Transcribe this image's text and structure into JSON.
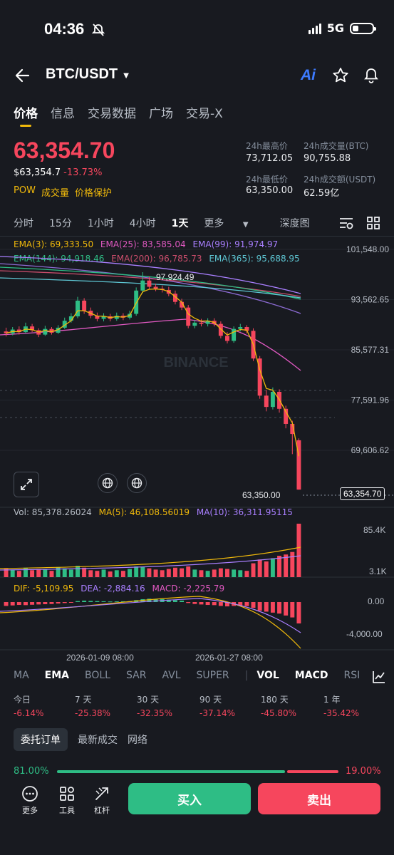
{
  "status": {
    "time": "04:36",
    "network": "5G"
  },
  "header": {
    "pair": "BTC/USDT",
    "ai_label": "Ai"
  },
  "tabs": [
    {
      "label": "价格"
    },
    {
      "label": "信息"
    },
    {
      "label": "交易数据"
    },
    {
      "label": "广场"
    },
    {
      "label": "交易-X"
    }
  ],
  "ticker": {
    "price": "63,354.70",
    "usd_price": "$63,354.7",
    "change": "-13.73%",
    "tags": [
      "POW",
      "成交量",
      "价格保护"
    ],
    "high_label": "24h最高价",
    "high": "73,712.05",
    "low_label": "24h最低价",
    "low": "63,350.00",
    "vol_btc_label": "24h成交量(BTC)",
    "vol_btc": "90,755.88",
    "vol_usdt_label": "24h成交额(USDT)",
    "vol_usdt": "62.59亿"
  },
  "intervals": {
    "items": [
      "分时",
      "15分",
      "1小时",
      "4小时",
      "1天"
    ],
    "more": "更多",
    "depth": "深度图",
    "selected": "1天"
  },
  "ema": {
    "ema3": "EMA(3): 69,333.50",
    "ema25": "EMA(25): 83,585.04",
    "ema99": "EMA(99): 91,974.97",
    "ema144": "EMA(144): 94,918.46",
    "ema200": "EMA(200): 96,785.73",
    "ema365": "EMA(365): 95,688.95"
  },
  "chart_data": {
    "type": "candlestick",
    "y_ticks": [
      "101,548.00",
      "93,562.65",
      "85,577.31",
      "77,591.96",
      "69,606.62"
    ],
    "ylim": [
      63000,
      101548
    ],
    "x_labels": [
      "2026-01-09 08:00",
      "2026-01-27 08:00"
    ],
    "high_marker": "97,924.49",
    "low_marker": "63,350.00",
    "current_price": "63,354.70",
    "candles": [
      {
        "o": 88500,
        "c": 88200,
        "h": 89100,
        "l": 87700
      },
      {
        "o": 88200,
        "c": 88800,
        "h": 89200,
        "l": 87900
      },
      {
        "o": 88800,
        "c": 88400,
        "h": 89300,
        "l": 88000
      },
      {
        "o": 88400,
        "c": 89300,
        "h": 89900,
        "l": 88200
      },
      {
        "o": 89300,
        "c": 88700,
        "h": 89700,
        "l": 88400
      },
      {
        "o": 88700,
        "c": 88000,
        "h": 89000,
        "l": 87600
      },
      {
        "o": 88000,
        "c": 88900,
        "h": 89400,
        "l": 87800
      },
      {
        "o": 88900,
        "c": 88300,
        "h": 89200,
        "l": 88000
      },
      {
        "o": 88300,
        "c": 89100,
        "h": 89500,
        "l": 88100
      },
      {
        "o": 89100,
        "c": 90200,
        "h": 90700,
        "l": 88900
      },
      {
        "o": 90200,
        "c": 90900,
        "h": 91400,
        "l": 89900
      },
      {
        "o": 90900,
        "c": 93400,
        "h": 94000,
        "l": 90600
      },
      {
        "o": 93400,
        "c": 91800,
        "h": 93800,
        "l": 91300
      },
      {
        "o": 91800,
        "c": 91000,
        "h": 92300,
        "l": 90600
      },
      {
        "o": 91000,
        "c": 90500,
        "h": 91500,
        "l": 90100
      },
      {
        "o": 90500,
        "c": 90900,
        "h": 91400,
        "l": 90100
      },
      {
        "o": 90900,
        "c": 90500,
        "h": 91300,
        "l": 90100
      },
      {
        "o": 90500,
        "c": 91000,
        "h": 91500,
        "l": 90200
      },
      {
        "o": 91000,
        "c": 90700,
        "h": 91400,
        "l": 90300
      },
      {
        "o": 90700,
        "c": 91300,
        "h": 91800,
        "l": 90400
      },
      {
        "o": 91300,
        "c": 95000,
        "h": 95500,
        "l": 91000
      },
      {
        "o": 95000,
        "c": 96600,
        "h": 97924,
        "l": 94600
      },
      {
        "o": 96600,
        "c": 95600,
        "h": 97200,
        "l": 95200
      },
      {
        "o": 95600,
        "c": 95300,
        "h": 96100,
        "l": 94900
      },
      {
        "o": 95300,
        "c": 95100,
        "h": 95800,
        "l": 94700
      },
      {
        "o": 95100,
        "c": 94500,
        "h": 95600,
        "l": 94100
      },
      {
        "o": 94500,
        "c": 93200,
        "h": 95000,
        "l": 92800
      },
      {
        "o": 93200,
        "c": 92300,
        "h": 93700,
        "l": 91900
      },
      {
        "o": 92300,
        "c": 89400,
        "h": 92700,
        "l": 89000
      },
      {
        "o": 89400,
        "c": 89900,
        "h": 90300,
        "l": 89000
      },
      {
        "o": 89900,
        "c": 89700,
        "h": 90500,
        "l": 89300
      },
      {
        "o": 89700,
        "c": 90200,
        "h": 90600,
        "l": 89300
      },
      {
        "o": 90200,
        "c": 89700,
        "h": 90600,
        "l": 89300
      },
      {
        "o": 89700,
        "c": 87800,
        "h": 90100,
        "l": 87400
      },
      {
        "o": 87800,
        "c": 87000,
        "h": 88400,
        "l": 86600
      },
      {
        "o": 87000,
        "c": 88900,
        "h": 89300,
        "l": 86700
      },
      {
        "o": 88900,
        "c": 89200,
        "h": 89700,
        "l": 88500
      },
      {
        "o": 89200,
        "c": 88600,
        "h": 89500,
        "l": 88200
      },
      {
        "o": 88600,
        "c": 84200,
        "h": 89000,
        "l": 83800
      },
      {
        "o": 84200,
        "c": 78300,
        "h": 84600,
        "l": 77800
      },
      {
        "o": 78300,
        "c": 76500,
        "h": 79200,
        "l": 75800
      },
      {
        "o": 76500,
        "c": 78900,
        "h": 79600,
        "l": 76100
      },
      {
        "o": 78900,
        "c": 76200,
        "h": 79300,
        "l": 75600
      },
      {
        "o": 76200,
        "c": 73800,
        "h": 76700,
        "l": 73100
      },
      {
        "o": 73800,
        "c": 72200,
        "h": 74300,
        "l": 69000
      },
      {
        "o": 71200,
        "c": 63355,
        "h": 71500,
        "l": 63350
      }
    ],
    "volume": {
      "label": "Vol: 85,378.26024",
      "ma5": "MA(5): 46,108.56019",
      "ma10": "MA(10): 36,311.95115",
      "ticks": [
        "85.4K",
        "3.1K"
      ],
      "values": [
        14,
        12,
        10,
        15,
        11,
        13,
        12,
        10,
        16,
        14,
        12,
        18,
        15,
        11,
        10,
        12,
        9,
        11,
        10,
        13,
        17,
        16,
        14,
        12,
        11,
        13,
        15,
        14,
        17,
        12,
        11,
        10,
        12,
        14,
        13,
        12,
        11,
        10,
        22,
        28,
        25,
        30,
        34,
        36,
        40,
        85
      ]
    },
    "macd": {
      "dif": "DIF: -5,109.95",
      "dea": "DEA: -2,884.16",
      "macd": "MACD: -2,225.79",
      "ticks": [
        "0.00",
        "-4,000.00"
      ],
      "hist": [
        -400,
        -350,
        -300,
        -320,
        -280,
        -250,
        -220,
        -200,
        -150,
        -100,
        -50,
        100,
        150,
        120,
        100,
        80,
        60,
        70,
        80,
        90,
        200,
        300,
        350,
        330,
        300,
        250,
        200,
        150,
        -100,
        -200,
        -250,
        -300,
        -320,
        -400,
        -450,
        -400,
        -380,
        -420,
        -600,
        -900,
        -1000,
        -1100,
        -1200,
        -1400,
        -1600,
        -2225
      ]
    }
  },
  "indicators": {
    "items": [
      "MA",
      "EMA",
      "BOLL",
      "SAR",
      "AVL",
      "SUPER",
      "VOL",
      "MACD",
      "RSI"
    ],
    "selected": [
      "EMA",
      "VOL",
      "MACD"
    ]
  },
  "performance": [
    {
      "label": "今日",
      "value": "-6.14%"
    },
    {
      "label": "7 天",
      "value": "-25.38%"
    },
    {
      "label": "30 天",
      "value": "-32.35%"
    },
    {
      "label": "90 天",
      "value": "-37.14%"
    },
    {
      "label": "180 天",
      "value": "-45.80%"
    },
    {
      "label": "1 年",
      "value": "-35.42%"
    }
  ],
  "order_tabs": [
    "委托订单",
    "最新成交",
    "网络"
  ],
  "ratio": {
    "buy": "81.00%",
    "sell": "19.00%",
    "buy_fraction": 0.81
  },
  "bottom": {
    "more": "更多",
    "tools": "工具",
    "leverage": "杠杆",
    "buy": "买入",
    "sell": "卖出"
  },
  "watermark": "BINANCE",
  "colors": {
    "up": "#2ebd85",
    "down": "#f6465d",
    "accent": "#f0b90b",
    "bg": "#181a20"
  }
}
